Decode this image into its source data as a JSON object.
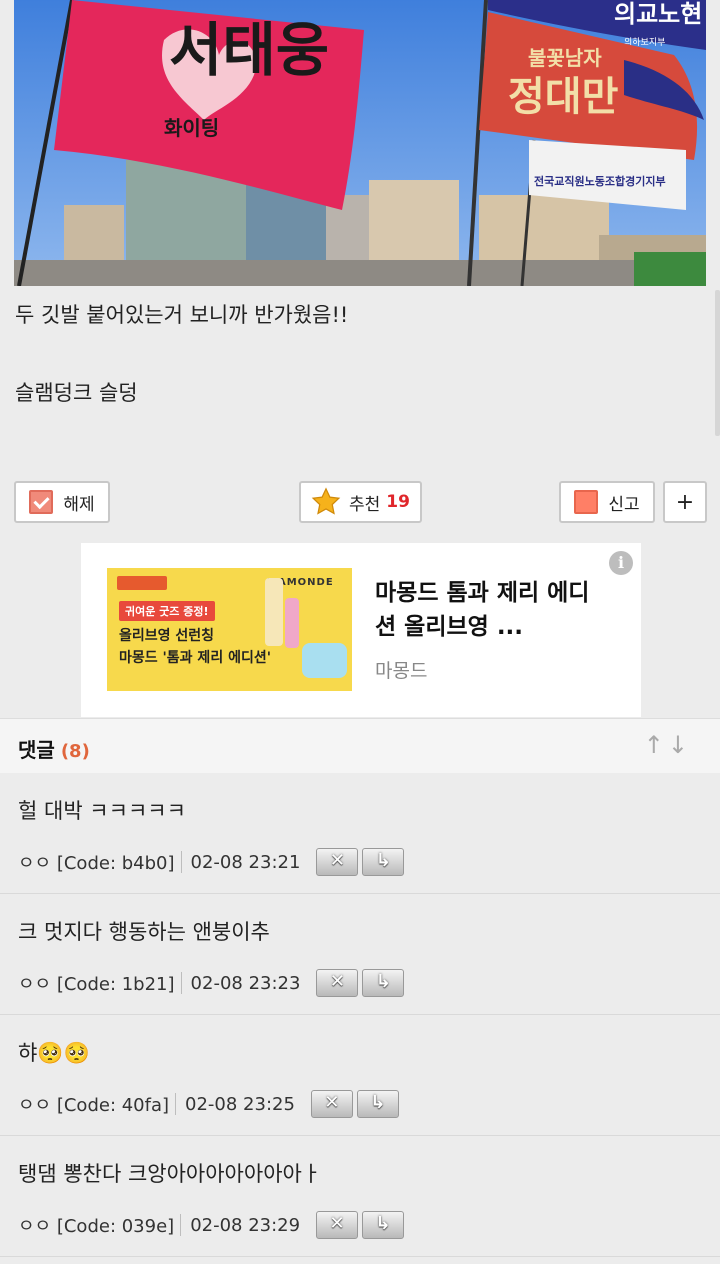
{
  "photo": {
    "flag_left_text": "서태웅",
    "flag_left_sub": "화이팅",
    "flag_right_text": "정대만",
    "flag_right_sub": "불꽃남자",
    "flag_top_text": "의교노현",
    "flag_top_sub": "의하보지부",
    "flag_lower_text": "전국교직원노동조합경기지부"
  },
  "post": {
    "line1": "두 깃발 붙어있는거 보니까 반가웠음!!",
    "line2": "슬램덩크 슬덩"
  },
  "actions": {
    "unvote_label": "해제",
    "recommend_label": "추천",
    "recommend_count": "19",
    "report_label": "신고",
    "plus_label": "+"
  },
  "ad": {
    "banner_tag": "귀여운 굿즈 증정!",
    "banner_line1": "올리브영 선런칭",
    "banner_line2": "마몽드 '톰과 제리 에디션'",
    "banner_brand": "MAMONDE",
    "title": "마몽드 톰과 제리 에디션 올리브영 ...",
    "advertiser": "마몽드",
    "info_icon": "i"
  },
  "comments": {
    "header": "댓글",
    "count": "(8)",
    "sort_icon": "↑↓",
    "items": [
      {
        "text": "헐 대박 ㅋㅋㅋㅋㅋ",
        "author": "ㅇㅇ [Code: b4b0]",
        "time": "02-08 23:21"
      },
      {
        "text": "크 멋지다 행동하는 앤붕이추",
        "author": "ㅇㅇ [Code: 1b21]",
        "time": "02-08 23:23"
      },
      {
        "text": "햐🥺🥺",
        "author": "ㅇㅇ [Code: 40fa]",
        "time": "02-08 23:25"
      },
      {
        "text": "탱댐 뽕찬다 크앙아아아아아아아ㅏ",
        "author": "ㅇㅇ [Code: 039e]",
        "time": "02-08 23:29"
      }
    ],
    "delete_icon": "✕",
    "reply_icon": "↳"
  }
}
